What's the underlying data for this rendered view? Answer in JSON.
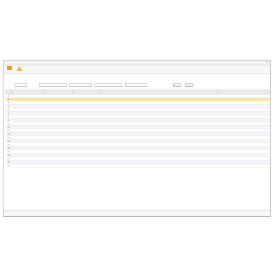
{
  "window": {
    "title": "",
    "close_label": "×"
  },
  "toolbar": {
    "buttons": [
      {
        "label": "",
        "icon": "folder-icon",
        "color": "#e6a21e"
      },
      {
        "label": "",
        "icon": "warning-icon",
        "color": "#f0b93a"
      }
    ]
  },
  "breadcrumb": "",
  "filters": {
    "search_label": "",
    "search_button": "",
    "reset_button": ""
  },
  "table": {
    "columns": [
      "",
      "",
      "",
      "",
      "",
      "",
      ""
    ],
    "rows": [
      [
        "1",
        "",
        "",
        "",
        "",
        "",
        ""
      ],
      [
        "2",
        "",
        "",
        "",
        "",
        "",
        ""
      ],
      [
        "3",
        "",
        "",
        "",
        "",
        "",
        ""
      ],
      [
        "4",
        "",
        "",
        "",
        "",
        "",
        ""
      ],
      [
        "5",
        "",
        "",
        "",
        "",
        "",
        ""
      ],
      [
        "6",
        "",
        "",
        "",
        "",
        "",
        ""
      ],
      [
        "7",
        "",
        "",
        "",
        "",
        "",
        ""
      ],
      [
        "8",
        "",
        "",
        "",
        "",
        "",
        ""
      ],
      [
        "9",
        "",
        "",
        "",
        "",
        "",
        ""
      ],
      [
        "10",
        "",
        "",
        "",
        "",
        "",
        ""
      ],
      [
        "11",
        "",
        "",
        "",
        "",
        "",
        ""
      ],
      [
        "12",
        "",
        "",
        "",
        "",
        "",
        ""
      ],
      [
        "13",
        "",
        "",
        "",
        "",
        "",
        ""
      ],
      [
        "14",
        "",
        "",
        "",
        "",
        "",
        ""
      ],
      [
        "15",
        "",
        "",
        "",
        "",
        "",
        ""
      ],
      [
        "16",
        "",
        "",
        "",
        "",
        "",
        ""
      ],
      [
        "17",
        "",
        "",
        "",
        "",
        "",
        ""
      ],
      [
        "18",
        "",
        "",
        "",
        "",
        "",
        ""
      ],
      [
        "19",
        "",
        "",
        "",
        "",
        "",
        ""
      ],
      [
        "20",
        "",
        "",
        "",
        "",
        "",
        ""
      ],
      [
        "21",
        "",
        "",
        "",
        "",
        "",
        ""
      ]
    ],
    "selected_row": 1
  },
  "status": {
    "text": ""
  },
  "colors": {
    "selection": "#f7e3b3",
    "header": "#ececec",
    "accent": "#e6a21e"
  }
}
